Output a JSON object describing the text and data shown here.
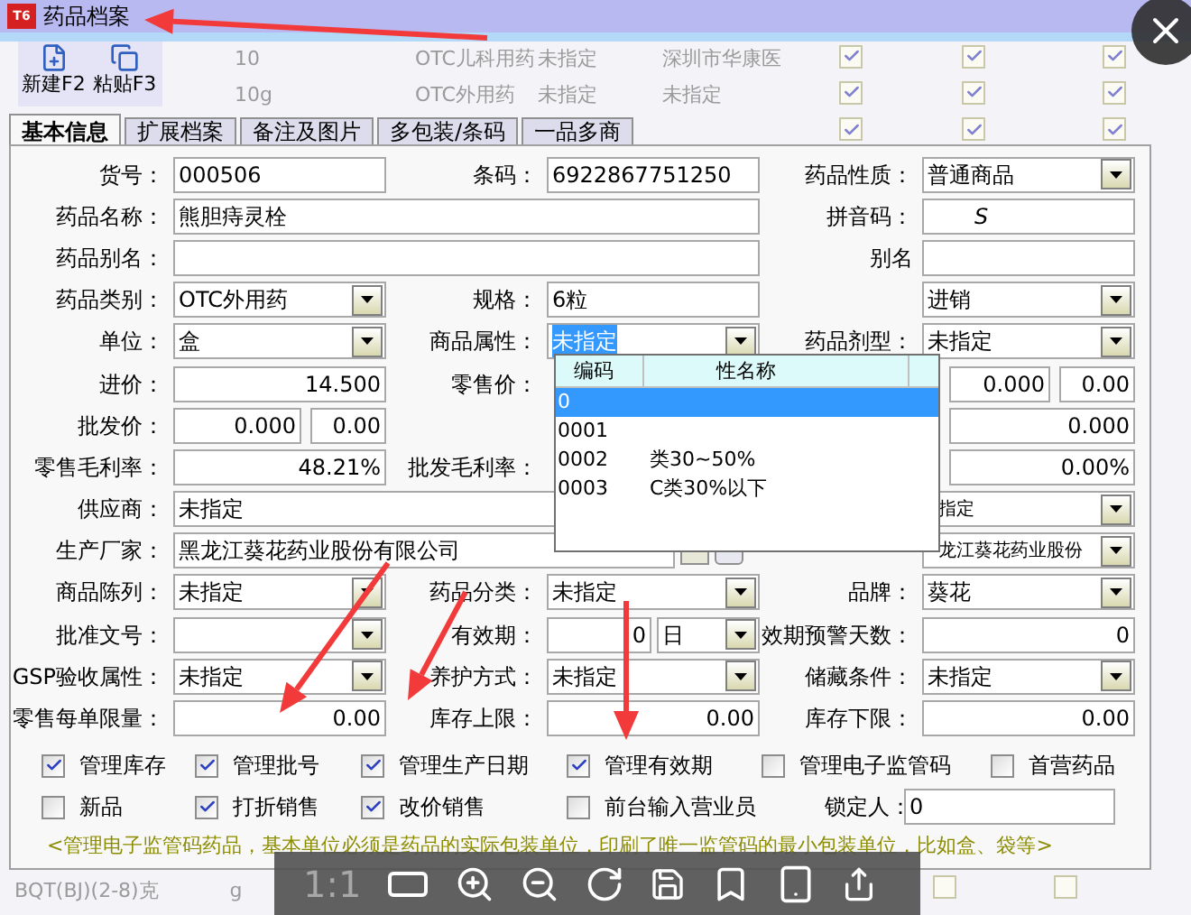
{
  "window": {
    "title": "药品档案",
    "logo_text": "T6"
  },
  "toolbar": [
    {
      "label": "新建F2",
      "kind": "new"
    },
    {
      "label": "粘贴F3",
      "kind": "paste"
    }
  ],
  "background_rows": [
    {
      "cells": [
        "10",
        "OTC儿科用药",
        "未指定",
        "深圳市华康医"
      ],
      "checks": [
        true,
        true,
        true
      ]
    },
    {
      "cells": [
        "10g",
        "OTC外用药",
        "未指定",
        "未指定"
      ],
      "checks": [
        true,
        true,
        true
      ]
    },
    {
      "checks": [
        true,
        true,
        true
      ]
    }
  ],
  "tabs": [
    {
      "label": "基本信息",
      "selected": true
    },
    {
      "label": "扩展档案",
      "selected": false
    },
    {
      "label": "备注及图片",
      "selected": false
    },
    {
      "label": "多包装/条码",
      "selected": false
    },
    {
      "label": "一品多商",
      "selected": false
    }
  ],
  "form_rows": [
    [
      {
        "label": "货号：",
        "value": "000506",
        "kind": "highlight"
      },
      {
        "label": "条码：",
        "value": "6922867751250",
        "kind": "highlight"
      },
      {
        "label": "药品性质：",
        "value": "普通商品",
        "kind": "select"
      }
    ],
    [
      {
        "label": "药品名称：",
        "value": "熊胆痔灵栓",
        "kind": "wide"
      },
      null,
      {
        "label": "拼音码：",
        "value": "S",
        "kind": "obscured"
      }
    ],
    [
      {
        "label": "药品别名：",
        "kind": "wide"
      },
      null,
      {
        "label": "别名",
        "kind": "text"
      }
    ],
    [
      {
        "label": "药品类别：",
        "value": "OTC外用药",
        "kind": "select"
      },
      {
        "label": "规格：",
        "value": "6粒",
        "kind": "text"
      },
      {
        "value": "进销",
        "kind": "select"
      }
    ],
    [
      {
        "label": "单位：",
        "value": "盒",
        "kind": "select"
      },
      {
        "label": "商品属性：",
        "value": "未指定",
        "kind": "selected_select"
      },
      {
        "label": "药品剂型：",
        "value": "未指定",
        "kind": "select"
      }
    ],
    [
      {
        "label": "进价：",
        "value": "14.500",
        "kind": "number"
      },
      {
        "label": "零售价：",
        "kind": "covered"
      },
      {
        "value": "0.000",
        "value2": "0.00",
        "kind": "partial_pair"
      }
    ],
    [
      {
        "label": "批发价：",
        "value": "0.000",
        "value2": "0.00",
        "kind": "pair"
      },
      null,
      {
        "value": "0.000",
        "kind": "partial"
      }
    ],
    [
      {
        "label": "零售毛利率：",
        "value": "48.21%",
        "kind": "number"
      },
      {
        "label": "批发毛利率：",
        "kind": "covered"
      },
      {
        "value": "0.00%",
        "kind": "partial"
      }
    ],
    [
      {
        "label": "供应商：",
        "value": "未指定",
        "kind": "long"
      },
      null,
      {
        "value": "指定",
        "kind": "covered_select"
      }
    ],
    [
      {
        "label": "生产厂家：",
        "value": "黑龙江葵花药业股份有限公司",
        "kind": "maker"
      },
      null,
      {
        "value": "龙江葵花药业股份",
        "kind": "covered_select"
      }
    ],
    [
      {
        "label": "商品陈列：",
        "value": "未指定",
        "kind": "select"
      },
      {
        "label": "药品分类：",
        "value": "未指定",
        "kind": "select"
      },
      {
        "label": "品牌：",
        "value": "葵花",
        "kind": "select"
      }
    ],
    [
      {
        "label": "批准文号：",
        "kind": "select"
      },
      {
        "label": "有效期：",
        "value": "0",
        "unit": "日",
        "kind": "unit"
      },
      {
        "label": "效期预警天数：",
        "value": "0",
        "kind": "number"
      }
    ],
    [
      {
        "label": "GSP验收属性：",
        "value": "未指定",
        "kind": "select"
      },
      {
        "label": "养护方式：",
        "value": "未指定",
        "kind": "select"
      },
      {
        "label": "储藏条件：",
        "value": "未指定",
        "kind": "select"
      }
    ],
    [
      {
        "label": "零售每单限量：",
        "value": "0.00",
        "kind": "number"
      },
      {
        "label": "库存上限：",
        "value": "0.00",
        "kind": "number"
      },
      {
        "label": "库存下限：",
        "value": "0.00",
        "kind": "number"
      }
    ]
  ],
  "dropdown": {
    "columns": [
      "编码",
      "性名称"
    ],
    "rows": [
      {
        "code": "0",
        "selected": true
      },
      {
        "code": "0001",
        "selected": false
      },
      {
        "code": "0002",
        "name": "类30~50%",
        "selected": false
      },
      {
        "code": "0003",
        "name": "C类30%以下",
        "selected": false
      }
    ]
  },
  "checks": [
    [
      {
        "label": "管理库存",
        "checked": true
      },
      {
        "label": "管理批号",
        "checked": true
      },
      {
        "label": "管理生产日期",
        "checked": true
      },
      {
        "label": "管理有效期",
        "checked": true
      },
      {
        "label": "管理电子监管码",
        "checked": false
      },
      {
        "label": "首营药品",
        "checked": false
      }
    ],
    [
      {
        "label": "新品",
        "checked": false
      },
      {
        "label": "打折销售",
        "checked": true
      },
      {
        "label": "改价销售",
        "checked": true
      },
      {
        "label": "前台输入营业员",
        "checked": false
      }
    ]
  ],
  "lock_field": {
    "label": "锁定人：",
    "value": "0"
  },
  "note": "<管理电子监管码药品，基本单位必须是药品的实际包装单位，印刷了唯一监管码的最小包装单位，比如盒、袋等>",
  "bottom_row": {
    "cells": [
      "BQT(BJ)(2-8)克",
      "g"
    ],
    "checks": [
      false,
      false
    ]
  },
  "viewer_toolbar": {
    "zoom_label": "1:1"
  }
}
